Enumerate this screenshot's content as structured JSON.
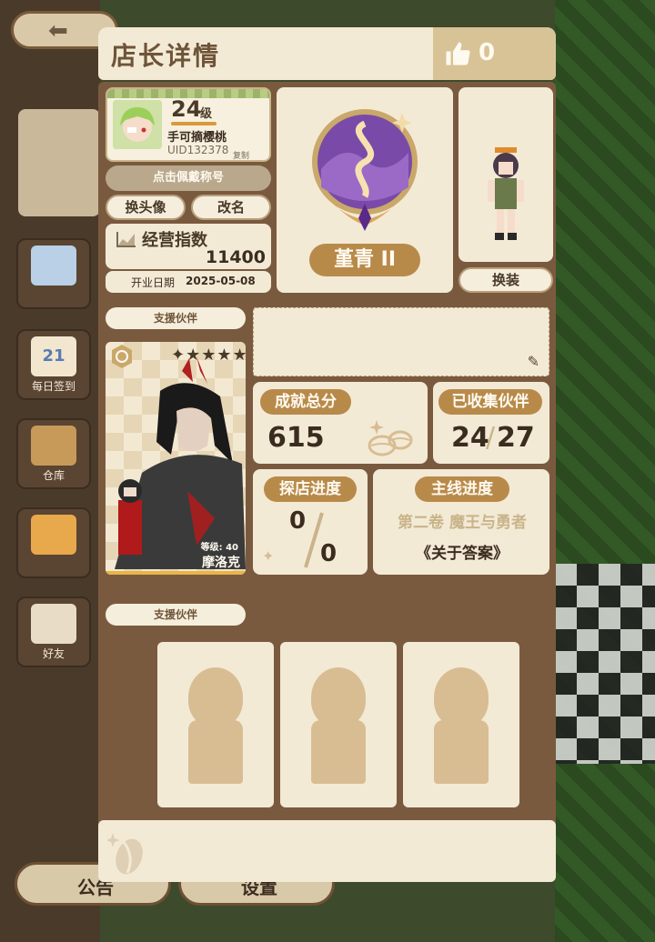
{
  "background": {
    "bottom_buttons": [
      "公告",
      "设置"
    ],
    "side_buttons": [
      "每日签到",
      "仓库",
      "好友"
    ],
    "calendar_day": "21"
  },
  "header": {
    "title": "店长详情",
    "likes": "0"
  },
  "profile": {
    "level": "24",
    "level_unit": "级",
    "nickname": "手可摘樱桃",
    "uid": "UID132378",
    "copy_label": "复制",
    "wear_title_button": "点击佩戴称号",
    "change_avatar_button": "换头像",
    "rename_button": "改名",
    "business_index_label": "经营指数",
    "business_index_value": "11400",
    "open_date_label": "开业日期",
    "open_date_value": "2025-05-08"
  },
  "rank": {
    "name": "堇青 II"
  },
  "outfit": {
    "change_button": "换装"
  },
  "partner": {
    "section_label": "支援伙伴",
    "stars": "✦★★★★",
    "level_text": "等级: 40",
    "name": "摩洛克"
  },
  "stats": {
    "achievement_label": "成就总分",
    "achievement_value": "615",
    "collected_label": "已收集伙伴",
    "collected_value": "24",
    "collected_total": "27",
    "explore_label": "探店进度",
    "explore_value": "0",
    "explore_total": "0",
    "story_label": "主线进度",
    "story_chapter": "第二卷 魔王与勇者",
    "story_episode": "《关于答案》"
  },
  "support": {
    "section_label": "支援伙伴"
  },
  "colors": {
    "panel_bg": "#7a5a3f",
    "card_bg": "#f3ead6",
    "accent_tag": "#b88a4a",
    "text_dark": "#3b2c20"
  }
}
